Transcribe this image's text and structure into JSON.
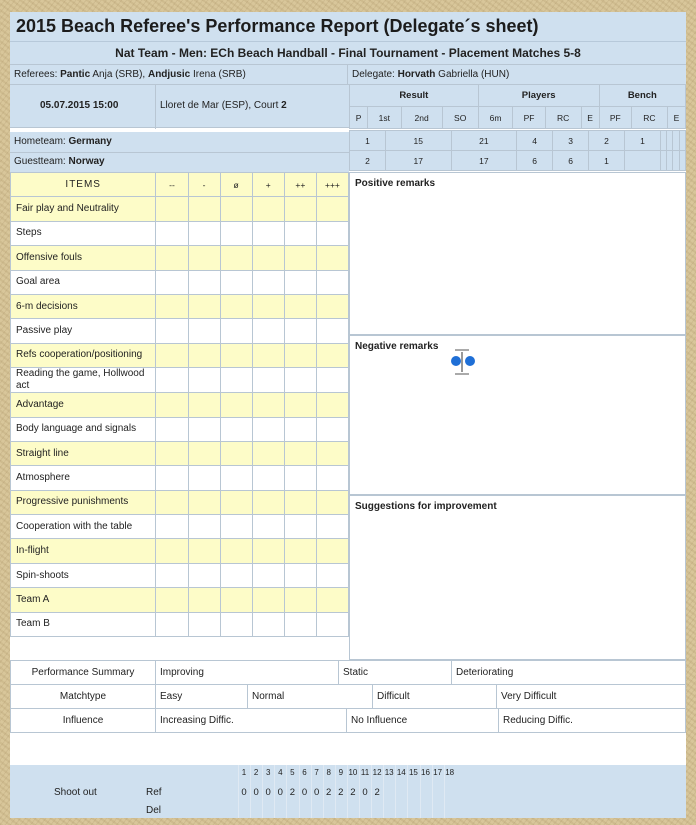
{
  "title": "2015 Beach Referee's Performance Report (Delegate´s sheet)",
  "subtitle": "Nat Team - Men: ECh Beach Handball - Final Tournament - Placement Matches 5-8",
  "referees_label": "Referees:",
  "referee1": "Pantic",
  "referee1_rest": "Anja (SRB),",
  "referee2": "Andjusic",
  "referee2_rest": "Irena (SRB)",
  "delegate_label": "Delegate:",
  "delegate_name": "Horvath",
  "delegate_rest": "Gabriella (HUN)",
  "date": "05.07.2015 15:00",
  "venue": "Lloret de Mar (ESP), Court",
  "court": "2",
  "result_header": "Result",
  "players_header": "Players",
  "bench_header": "Bench",
  "col_headers": [
    "P",
    "1st",
    "2nd",
    "SO",
    "6m",
    "PF",
    "RC",
    "E",
    "PF",
    "RC",
    "E"
  ],
  "hometeam_label": "Hometeam:",
  "hometeam": "Germany",
  "guestteam_label": "Guestteam:",
  "guestteam": "Norway",
  "home_values": [
    "1",
    "15",
    "21",
    "4",
    "3",
    "2",
    "1",
    "",
    "",
    "",
    ""
  ],
  "guest_values": [
    "2",
    "17",
    "17",
    "6",
    "6",
    "1",
    "",
    "",
    "",
    "",
    ""
  ],
  "items_header": "ITEMS",
  "rating_headers": [
    "--",
    "-",
    "ø",
    "+",
    "++",
    "+++"
  ],
  "items": [
    "Fair play and Neutrality",
    "Steps",
    "Offensive fouls",
    "Goal area",
    "6-m decisions",
    "Passive play",
    "Refs cooperation/positioning",
    "Reading the game, Hollwood act",
    "Advantage",
    "Body language and signals",
    "Straight line",
    "Atmosphere",
    "Progressive punishments",
    "Cooperation with the table",
    "In-flight",
    "Spin-shoots",
    "Team A",
    "Team B"
  ],
  "positive_remarks": "Positive remarks",
  "negative_remarks": "Negative remarks",
  "suggestions": "Suggestions for improvement",
  "summary_rows": [
    {
      "label": "Performance Summary",
      "options": [
        "Improving",
        "Static",
        "Deteriorating"
      ]
    },
    {
      "label": "Matchtype",
      "options": [
        "Easy",
        "Normal",
        "Difficult",
        "Very Difficult"
      ]
    },
    {
      "label": "Influence",
      "options": [
        "Increasing Diffic.",
        "No Influence",
        "Reducing Diffic."
      ]
    }
  ],
  "shootout": {
    "label": "Shoot out",
    "ref_label": "Ref",
    "del_label": "Del",
    "numbers": [
      "1",
      "2",
      "3",
      "4",
      "5",
      "6",
      "7",
      "8",
      "9",
      "10",
      "11",
      "12",
      "13",
      "14",
      "15",
      "16",
      "17",
      "18"
    ],
    "ref_values": [
      "0",
      "0",
      "0",
      "0",
      "2",
      "0",
      "0",
      "2",
      "2",
      "2",
      "0",
      "2"
    ]
  },
  "colors": {
    "header_blue": "#cfe0ef",
    "item_yellow": "#fdfcc8",
    "handle_blue": "#1f6fd6"
  }
}
